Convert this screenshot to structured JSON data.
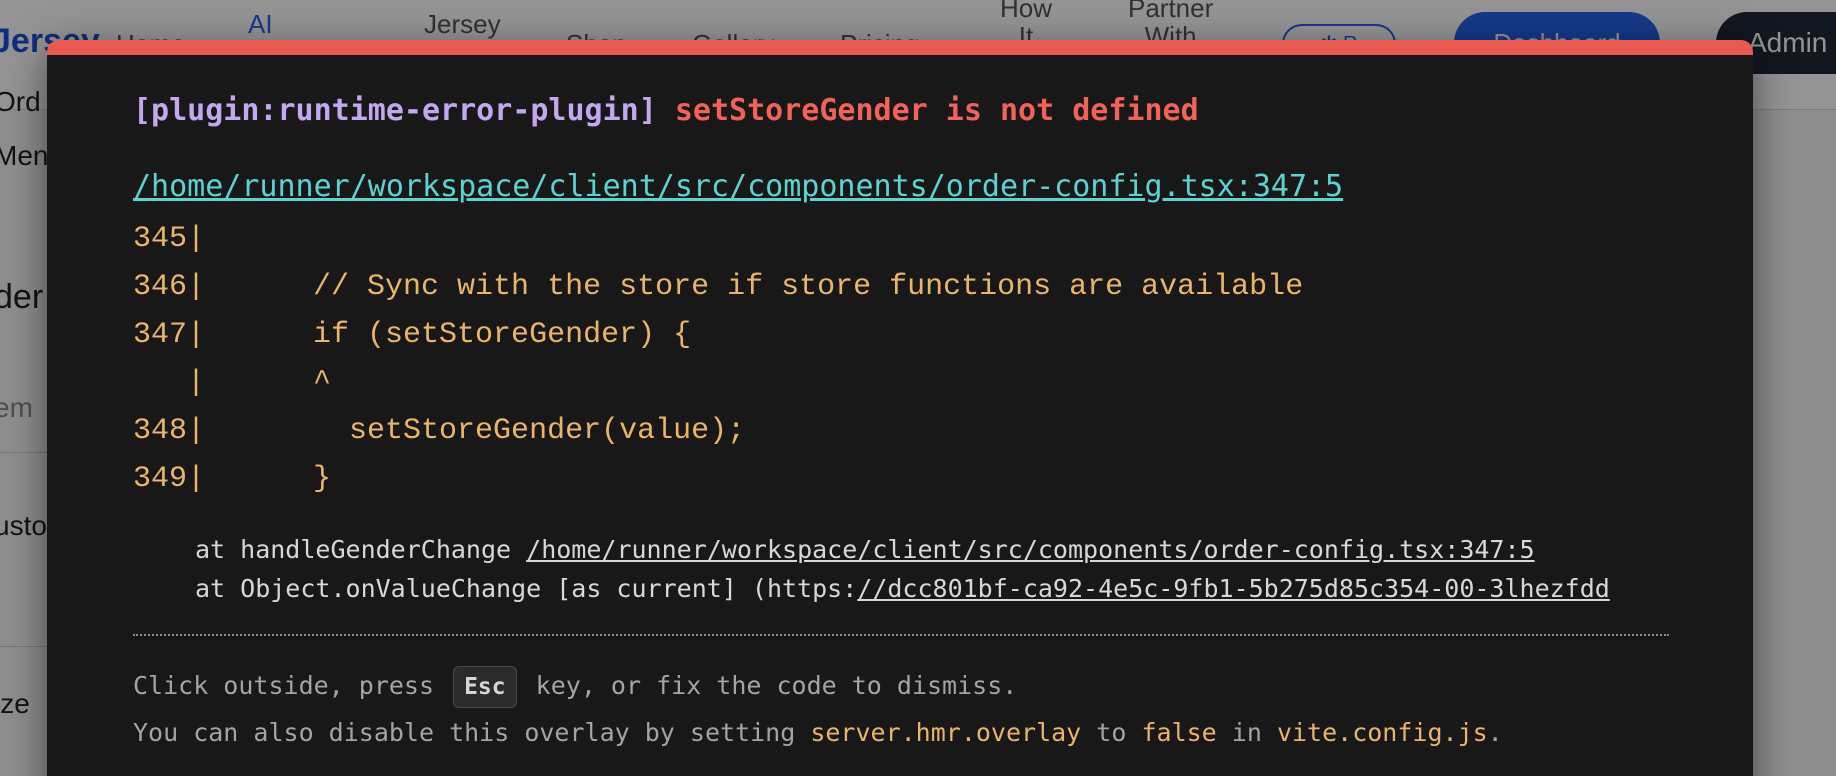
{
  "background_app": {
    "logo": "Jersey",
    "nav": {
      "home": "Home",
      "ai": "AI",
      "jersey": "Jersey",
      "shop": "Shop",
      "gallery": "Gallery",
      "pricing": "Pricing",
      "how_it_line1": "How",
      "how_it_line2": "It",
      "partner_line1": "Partner",
      "partner_line2": "With",
      "pill": "R",
      "dashboard": "Dashboard",
      "admin": "Admin"
    },
    "side": {
      "s1": "Ord",
      "s2": "Men",
      "s3": "der",
      "s4": "em",
      "s5": "usto",
      "s6": "ize"
    }
  },
  "overlay": {
    "colors": {
      "accent_bar": "#e8594f",
      "plugin": "#c3a7ef",
      "message": "#f0625a",
      "file_link": "#5dd3d1",
      "code": "#e9b56a"
    },
    "plugin": "[plugin:runtime-error-plugin]",
    "message": "setStoreGender is not defined",
    "file": "/home/runner/workspace/client/src/components/order-config.tsx:347:5",
    "code_frame": [
      "345|",
      "346|      // Sync with the store if store functions are available",
      "347|      if (setStoreGender) {",
      "   |      ^",
      "348|        setStoreGender(value);",
      "349|      }"
    ],
    "stack": {
      "line1_prefix": "at handleGenderChange ",
      "line1_link": "/home/runner/workspace/client/src/components/order-config.tsx:347:5",
      "line2_prefix": "at Object.onValueChange [as current] (https:",
      "line2_link": "//dcc801bf-ca92-4e5c-9fb1-5b275d85c354-00-3lhezfdd"
    },
    "tip": {
      "line1_part1": "Click outside, press ",
      "key": "Esc",
      "line1_part2": " key, or fix the code to dismiss.",
      "line2_part1": "You can also disable this overlay by setting ",
      "setting": "server.hmr.overlay",
      "line2_part2": " to ",
      "value": "false",
      "line2_part3": " in ",
      "config_file": "vite.config.js",
      "line2_part4": "."
    }
  }
}
